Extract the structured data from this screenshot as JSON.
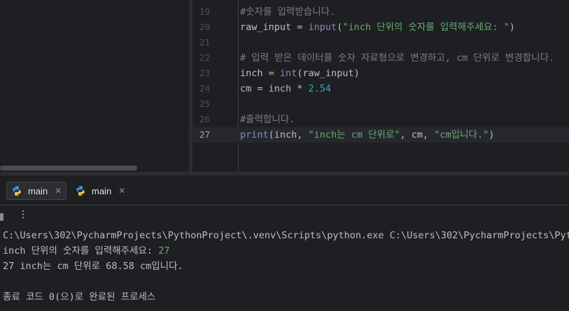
{
  "editor": {
    "lines": [
      {
        "num": "19",
        "tokens": [
          {
            "t": "#숫자를 입력받습니다.",
            "k": "comment"
          }
        ]
      },
      {
        "num": "20",
        "tokens": [
          {
            "t": "raw_input = ",
            "k": "plain"
          },
          {
            "t": "input",
            "k": "builtin"
          },
          {
            "t": "(",
            "k": "plain"
          },
          {
            "t": "\"inch 단위의 숫자를 입력해주세요: \"",
            "k": "string"
          },
          {
            "t": ")",
            "k": "plain"
          }
        ]
      },
      {
        "num": "21",
        "tokens": []
      },
      {
        "num": "22",
        "tokens": [
          {
            "t": "# 입력 받은 데이터를 숫자 자료형으로 변경하고, cm 단위로 변경합니다.",
            "k": "comment"
          }
        ]
      },
      {
        "num": "23",
        "tokens": [
          {
            "t": "inch = ",
            "k": "plain"
          },
          {
            "t": "int",
            "k": "builtin"
          },
          {
            "t": "(raw_input)",
            "k": "plain"
          }
        ]
      },
      {
        "num": "24",
        "tokens": [
          {
            "t": "cm = inch * ",
            "k": "plain"
          },
          {
            "t": "2.54",
            "k": "number"
          }
        ]
      },
      {
        "num": "25",
        "tokens": []
      },
      {
        "num": "26",
        "tokens": [
          {
            "t": "#출력합니다.",
            "k": "comment"
          }
        ]
      },
      {
        "num": "27",
        "current": true,
        "tokens": [
          {
            "t": "print",
            "k": "builtin"
          },
          {
            "t": "(inch, ",
            "k": "plain"
          },
          {
            "t": "\"inch는 cm 단위로\"",
            "k": "string"
          },
          {
            "t": ", cm, ",
            "k": "plain"
          },
          {
            "t": "\"cm입니다.\"",
            "k": "string"
          },
          {
            "t": ")",
            "k": "plain"
          }
        ]
      }
    ]
  },
  "run_panel": {
    "tabs": [
      {
        "label": "main",
        "active": true,
        "icon": "python-icon"
      },
      {
        "label": "main",
        "active": false,
        "icon": "python-icon"
      }
    ],
    "more_label": "⋮",
    "console": {
      "command": "C:\\Users\\302\\PycharmProjects\\PythonProject\\.venv\\Scripts\\python.exe C:\\Users\\302\\PycharmProjects\\Pyth",
      "prompt": "inch 단위의 숫자를 입력해주세요: ",
      "prompt_input": "27",
      "result": "27 inch는 cm 단위로 68.58 cm입니다.",
      "exit": "종료 코드 0(으)로 완료된 프로세스"
    }
  },
  "colors": {
    "background": "#1e1f22",
    "comment": "#7a7e85",
    "string": "#6aab73",
    "builtin": "#8888c6",
    "number": "#2aacb8",
    "text": "#bcbec4"
  }
}
